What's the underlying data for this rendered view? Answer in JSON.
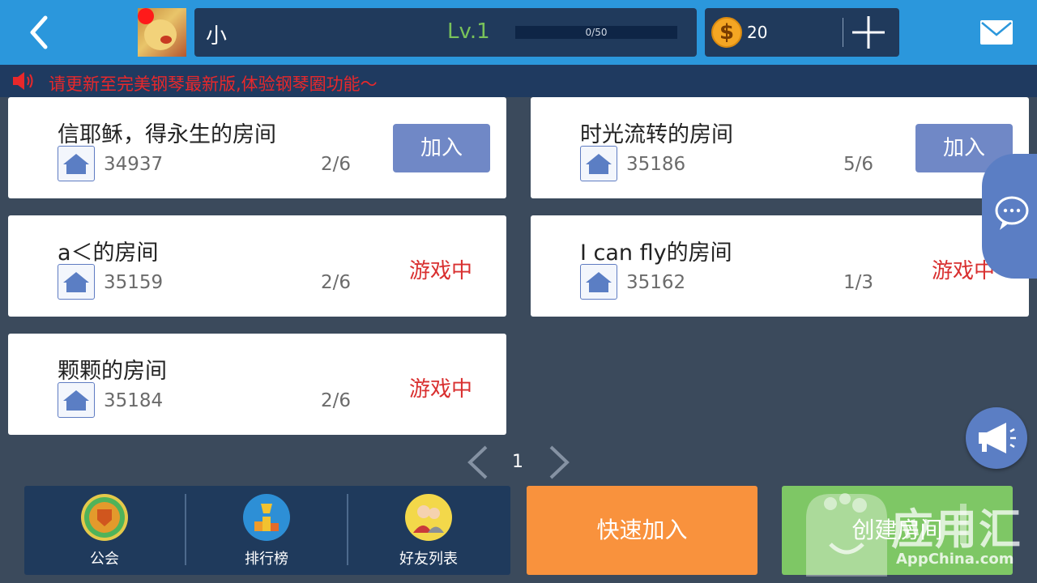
{
  "header": {
    "username": "小",
    "level": "Lv.1",
    "xp_text": "0/50",
    "xp_fraction": 0,
    "coins": "20",
    "icons": [
      "back-icon",
      "mail-icon",
      "plus-icon",
      "coin-icon"
    ]
  },
  "notice": {
    "text": "请更新至完美钢琴最新版,体验钢琴圈功能～"
  },
  "rooms": [
    {
      "title": "信耶稣，得永生的房间",
      "id": "34937",
      "count": "2/6",
      "action": "加入"
    },
    {
      "title": "时光流转的房间",
      "id": "35186",
      "count": "5/6",
      "action": "加入"
    },
    {
      "title": "a＜的房间",
      "id": "35159",
      "count": "2/6",
      "status": "游戏中"
    },
    {
      "title": "I can fly的房间",
      "id": "35162",
      "count": "1/3",
      "status": "游戏中"
    },
    {
      "title": "颗颗的房间",
      "id": "35184",
      "count": "2/6",
      "status": "游戏中"
    }
  ],
  "pagination": {
    "page": "1"
  },
  "bottom_nav": [
    {
      "label": "公会",
      "icon": "guild-icon"
    },
    {
      "label": "排行榜",
      "icon": "leaderboard-icon"
    },
    {
      "label": "好友列表",
      "icon": "friends-icon"
    }
  ],
  "actions": {
    "quick_join": "快速加入",
    "create_room": "创建房间"
  },
  "watermark": {
    "main": "应用汇",
    "sub": "AppChina.com"
  },
  "colors": {
    "topbar": "#2b97dc",
    "background": "#3b4a5c",
    "join_button": "#7088c6",
    "in_game_red": "#d93030",
    "quick_join": "#f9923d",
    "create_room": "#7ec765",
    "level_green": "#79c25a"
  }
}
